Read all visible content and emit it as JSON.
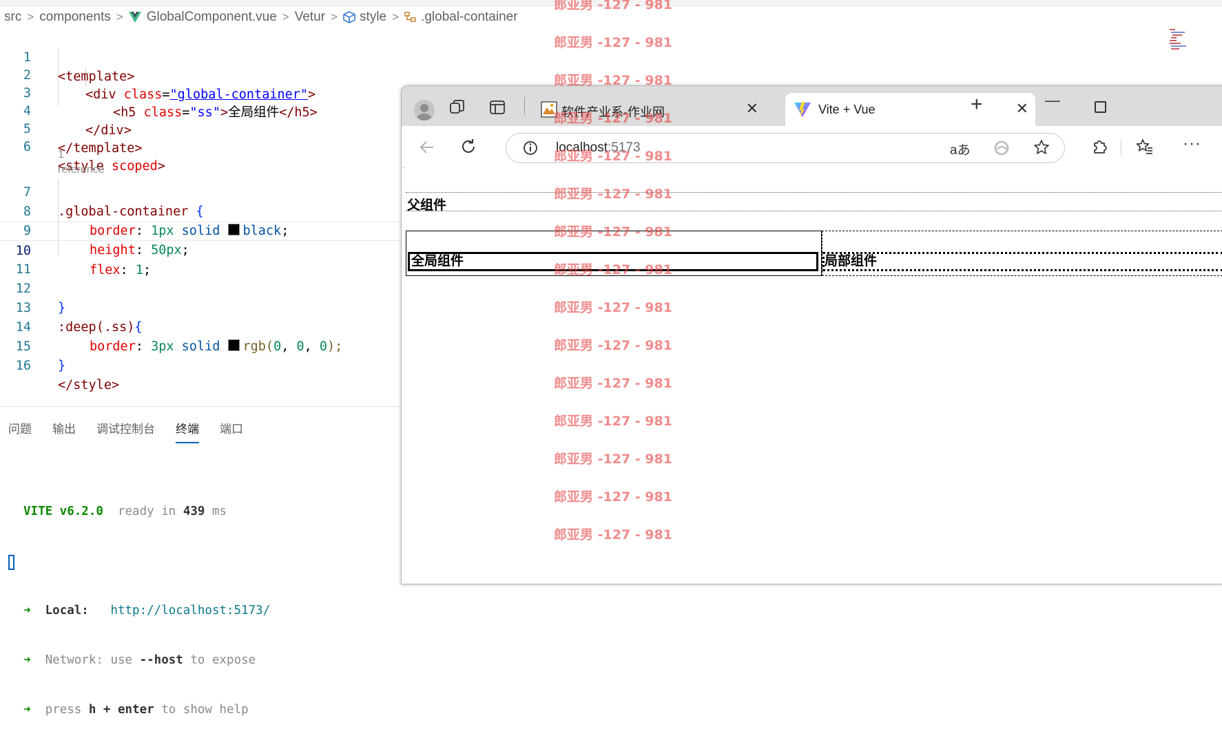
{
  "breadcrumb": {
    "src": "src",
    "components": "components",
    "file": "GlobalComponent.vue",
    "vetur": "Vetur",
    "style": "style",
    "selector": ".global-container"
  },
  "code": {
    "reference_hint": "1 reference",
    "line_numbers": [
      "1",
      "2",
      "3",
      "4",
      "5",
      "6",
      "7",
      "8",
      "9",
      "10",
      "11",
      "12",
      "13",
      "14",
      "15",
      "16"
    ],
    "l1_tag": "<template>",
    "l2_open": "<div ",
    "l2_attr": "class",
    "l2_eq": "=",
    "l2_val": "\"global-container\"",
    "l2_close": ">",
    "l3_open": "<h5 ",
    "l3_attr": "class",
    "l3_eq": "=",
    "l3_val": "\"ss\"",
    "l3_gt": ">",
    "l3_text": "全局组件",
    "l3_close": "</h5>",
    "l4_tag": "</div>",
    "l5_tag": "</template>",
    "l6_open": "<style ",
    "l6_attr": "scoped",
    "l6_close": ">",
    "l7_sel": ".global-container",
    "l7_brace": " {",
    "l8_prop": "border",
    "l8_colon": ": ",
    "l8_num": "1px",
    "l8_val1": " solid ",
    "l8_val2": "black",
    "l8_semi": ";",
    "l9_prop": "height",
    "l9_colon": ": ",
    "l9_num": "50px",
    "l9_semi": ";",
    "l10_prop": "flex",
    "l10_colon": ": ",
    "l10_num": "1",
    "l10_semi": ";",
    "l12_brace": "}",
    "l13_sel": ":deep(.ss)",
    "l13_brace": "{",
    "l14_prop": "border",
    "l14_colon": ": ",
    "l14_num": "3px",
    "l14_val1": " solid ",
    "l14_fn": "rgb(",
    "l14_a": "0",
    "l14_c1": ", ",
    "l14_b": "0",
    "l14_c2": ", ",
    "l14_c": "0",
    "l14_end": ");",
    "l15_brace": "}",
    "l16_tag": "</style>"
  },
  "panel": {
    "tabs": [
      "问题",
      "输出",
      "调试控制台",
      "终端",
      "端口"
    ],
    "active_tab": "终端"
  },
  "terminal": {
    "vite": "VITE v6.2.0",
    "ready": "  ready in ",
    "ms_value": "439",
    "ms_unit": " ms",
    "arrow": "➜",
    "local_label": "  Local:",
    "local_url": "   http://localhost:5173/",
    "network_label": "  Network",
    "network_rest1": ": use ",
    "network_flag": "--host",
    "network_rest2": " to expose",
    "help_rest1": "  press ",
    "help_key": "h + enter",
    "help_rest2": " to show help"
  },
  "browser": {
    "tab1_title": "软件产业系-作业网",
    "tab2_title": "Vite + Vue",
    "url_host": "localhost",
    "url_port": ":5173",
    "translate_glyph": "aあ",
    "page": {
      "parent_title": "父组件",
      "global_title": "全局组件",
      "local_title": "局部组件"
    }
  },
  "watermark": {
    "text": "郎亚男 -127 - 981",
    "count": 15
  },
  "colors": {
    "watermark": "#e84646",
    "accent": "#005fb8",
    "vue_green": "#41b883",
    "vue_dark": "#34495e"
  }
}
